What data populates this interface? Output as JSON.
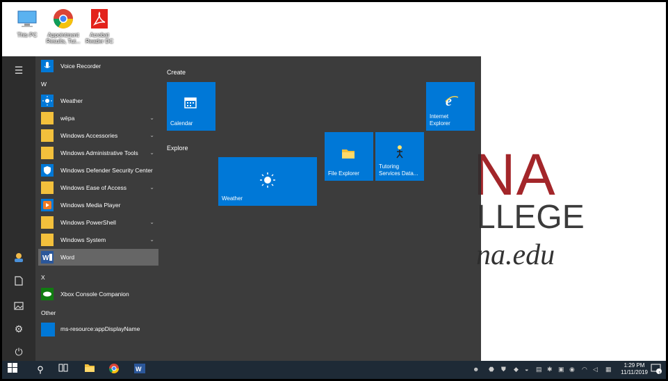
{
  "desktop": {
    "icons": [
      {
        "label": "This PC"
      },
      {
        "label": "Appointment Results, Tut..."
      },
      {
        "label": "Acrobat Reader DC"
      }
    ],
    "wallpaper": {
      "line1": "NA",
      "line2": "LLEGE",
      "line3": "na.edu"
    }
  },
  "start_menu": {
    "apps": [
      {
        "label": "Voice Recorder"
      },
      {
        "label": "Weather"
      },
      {
        "label": "wēpa",
        "chevron": "⌄"
      },
      {
        "label": "Windows Accessories",
        "chevron": "⌄"
      },
      {
        "label": "Windows Administrative Tools",
        "chevron": "⌄"
      },
      {
        "label": "Windows Defender Security Center"
      },
      {
        "label": "Windows Ease of Access",
        "chevron": "⌄"
      },
      {
        "label": "Windows Media Player"
      },
      {
        "label": "Windows PowerShell",
        "chevron": "⌄"
      },
      {
        "label": "Windows System",
        "chevron": "⌄"
      },
      {
        "label": "Word"
      },
      {
        "label": "Xbox Console Companion"
      },
      {
        "label": "ms-resource:appDisplayName"
      }
    ],
    "letters": [
      "W",
      "X",
      "Other"
    ],
    "groups": [
      "Create",
      "Explore"
    ],
    "tiles": {
      "calendar": "Calendar",
      "weather": "Weather",
      "file_explorer": "File Explorer",
      "tutoring": "Tutoring Services Data...",
      "ie": "Internet Explorer"
    }
  },
  "taskbar": {
    "clock_time": "1:29 PM",
    "clock_date": "11/11/2019",
    "notification_count": "1"
  },
  "colors": {
    "accent": "#0078d7",
    "start_bg": "#2d2d2d",
    "taskbar": "#1e2a36"
  }
}
